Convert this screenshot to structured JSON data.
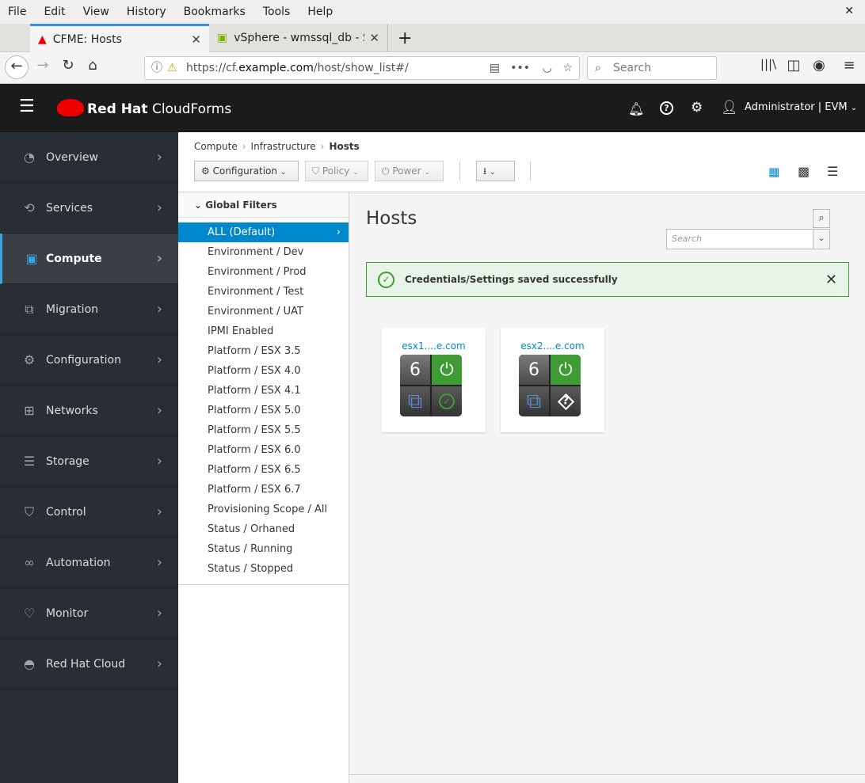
{
  "browser": {
    "menu": [
      "File",
      "Edit",
      "View",
      "History",
      "Bookmarks",
      "Tools",
      "Help"
    ],
    "tabs": [
      {
        "title": "CFME: Hosts"
      },
      {
        "title": "vSphere - wmssql_db - S"
      }
    ],
    "url_prefix": "https://cf.",
    "url_domain": "example.com",
    "url_path": "/host/show_list#/",
    "search_placeholder": "Search"
  },
  "header": {
    "brand": "Red Hat",
    "product": "CloudForms",
    "user": "Administrator | EVM"
  },
  "sidebar": {
    "items": [
      {
        "label": "Overview",
        "icon": "tachometer-icon"
      },
      {
        "label": "Services",
        "icon": "services-icon"
      },
      {
        "label": "Compute",
        "icon": "cpu-icon",
        "active": true
      },
      {
        "label": "Migration",
        "icon": "migration-icon"
      },
      {
        "label": "Configuration",
        "icon": "gear-icon"
      },
      {
        "label": "Networks",
        "icon": "network-icon"
      },
      {
        "label": "Storage",
        "icon": "database-icon"
      },
      {
        "label": "Control",
        "icon": "shield-icon"
      },
      {
        "label": "Automation",
        "icon": "automation-icon"
      },
      {
        "label": "Monitor",
        "icon": "heartbeat-icon"
      },
      {
        "label": "Red Hat Cloud",
        "icon": "redhat-icon"
      }
    ]
  },
  "breadcrumb": [
    "Compute",
    "Infrastructure",
    "Hosts"
  ],
  "toolbar": {
    "configuration": "Configuration",
    "policy": "Policy",
    "power": "Power"
  },
  "filters": {
    "title": "Global Filters",
    "items": [
      "ALL (Default)",
      "Environment / Dev",
      "Environment / Prod",
      "Environment / Test",
      "Environment / UAT",
      "IPMI Enabled",
      "Platform / ESX 3.5",
      "Platform / ESX 4.0",
      "Platform / ESX 4.1",
      "Platform / ESX 5.0",
      "Platform / ESX 5.5",
      "Platform / ESX 6.0",
      "Platform / ESX 6.5",
      "Platform / ESX 6.7",
      "Provisioning Scope / All",
      "Status / Orhaned",
      "Status / Running",
      "Status / Stopped"
    ]
  },
  "main": {
    "title": "Hosts",
    "search_placeholder": "Search",
    "alert": "Credentials/Settings saved successfully",
    "hosts": [
      {
        "name": "esx1....e.com",
        "vms": "6",
        "power": "on",
        "auth": "valid"
      },
      {
        "name": "esx2....e.com",
        "vms": "6",
        "power": "on",
        "auth": "unknown"
      }
    ]
  },
  "colors": {
    "accent": "#0088ce",
    "success": "#3f9c35",
    "header": "#1b1b1b",
    "sidebar": "#292e34"
  }
}
